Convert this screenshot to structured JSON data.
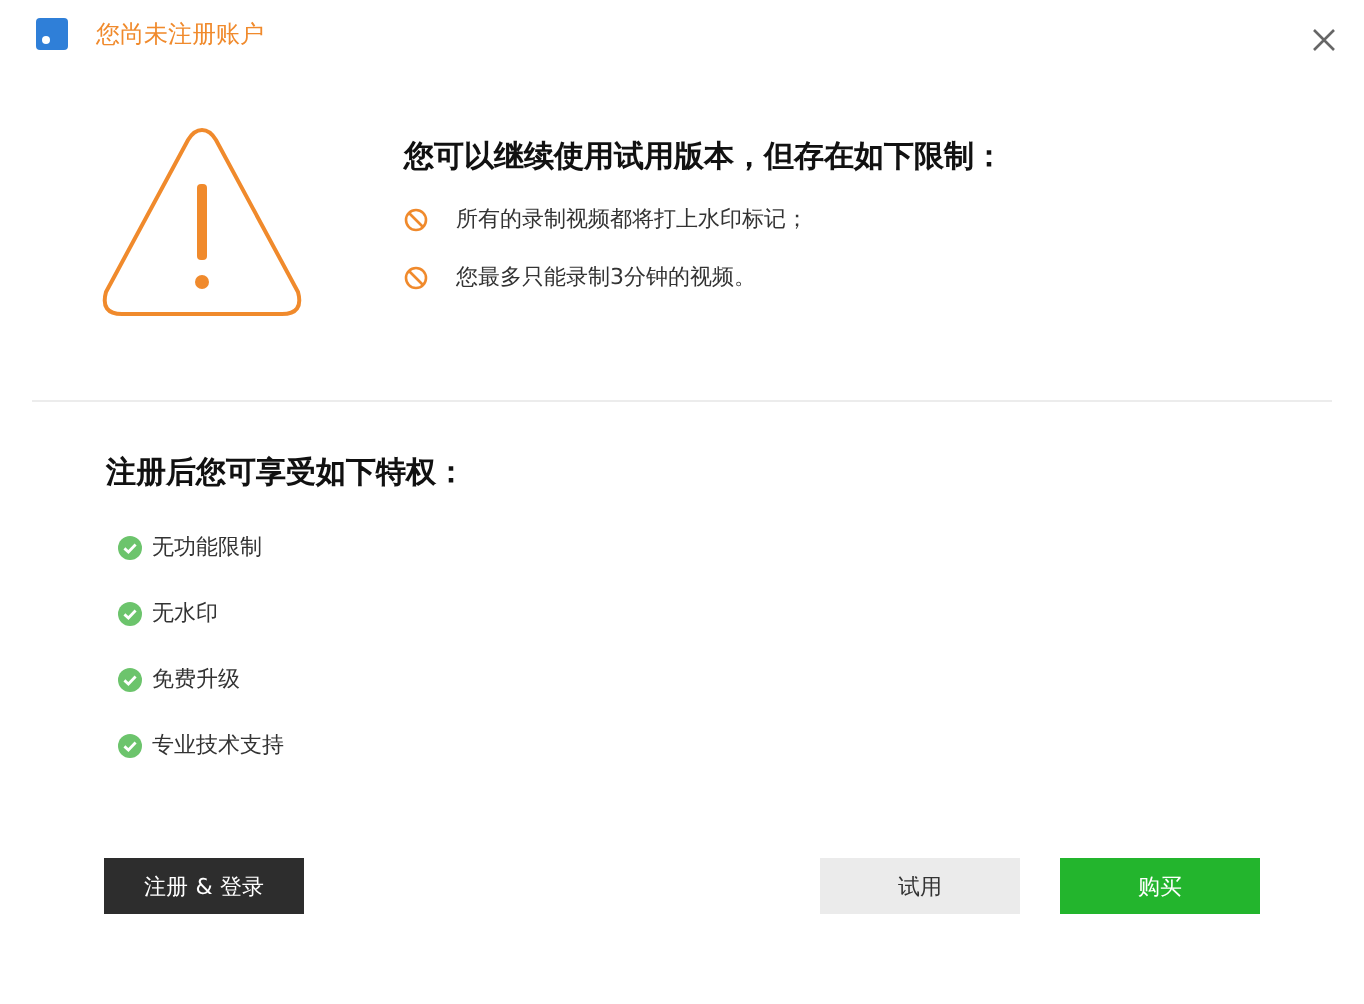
{
  "window": {
    "title": "您尚未注册账户"
  },
  "trial": {
    "heading": "您可以继续使用试用版本，但存在如下限制：",
    "limits": [
      "所有的录制视频都将打上水印标记；",
      "您最多只能录制3分钟的视频。"
    ]
  },
  "register": {
    "heading": "注册后您可享受如下特权：",
    "benefits": [
      "无功能限制",
      "无水印",
      "免费升级",
      "专业技术支持"
    ]
  },
  "buttons": [
    {
      "kind": "dark",
      "label": "注册 & 登录"
    },
    {
      "kind": "light",
      "label": "试用"
    },
    {
      "kind": "green",
      "label": "购买"
    }
  ]
}
